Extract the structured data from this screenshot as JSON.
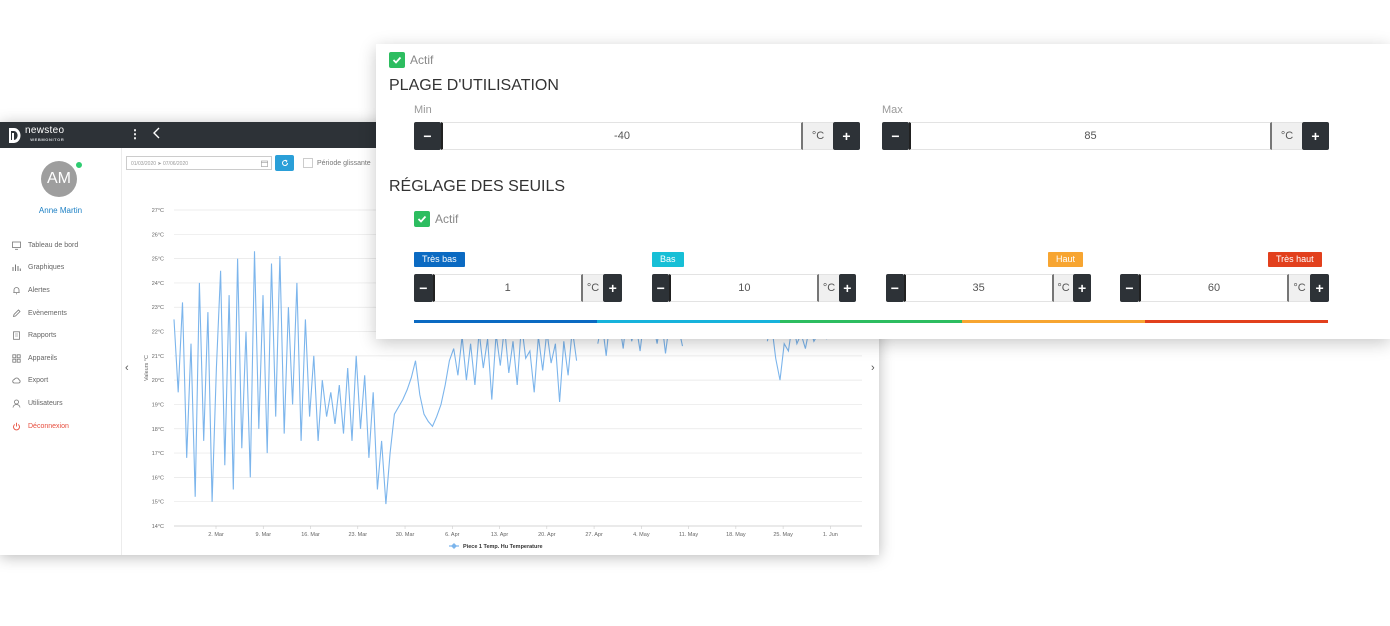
{
  "app": {
    "logo": {
      "name": "newsteo",
      "sub": "WEBMONITOR"
    },
    "sidebar": {
      "avatar": "AM",
      "user_name": "Anne Martin",
      "items": [
        {
          "label": "Tableau de bord",
          "icon": "monitor-icon"
        },
        {
          "label": "Graphiques",
          "icon": "bar-chart-icon"
        },
        {
          "label": "Alertes",
          "icon": "bell-icon"
        },
        {
          "label": "Evènements",
          "icon": "pencil-icon"
        },
        {
          "label": "Rapports",
          "icon": "document-icon"
        },
        {
          "label": "Appareils",
          "icon": "grid-icon"
        },
        {
          "label": "Export",
          "icon": "cloud-icon"
        },
        {
          "label": "Utilisateurs",
          "icon": "user-icon"
        },
        {
          "label": "Déconnexion",
          "icon": "power-icon"
        }
      ]
    },
    "filter": {
      "date_range": "01/03/2020 ➤ 07/06/2020",
      "sliding_label": "Période glissante"
    }
  },
  "chart_data": {
    "type": "line",
    "ylabel": "Valeurs °C",
    "ylim": [
      14,
      27
    ],
    "yticks": [
      "27°C",
      "26°C",
      "25°C",
      "24°C",
      "23°C",
      "22°C",
      "21°C",
      "20°C",
      "19°C",
      "18°C",
      "17°C",
      "16°C",
      "15°C",
      "14°C"
    ],
    "xticks": [
      "2. Mar",
      "9. Mar",
      "16. Mar",
      "23. Mar",
      "30. Mar",
      "6. Apr",
      "13. Apr",
      "20. Apr",
      "27. Apr",
      "4. May",
      "11. May",
      "18. May",
      "25. May",
      "1. Jun"
    ],
    "grid": true,
    "series": [
      {
        "name": "Piece 1 Temp. Hu Temperature",
        "color": "#7cb5ec",
        "x": [
          0,
          1,
          2,
          3,
          4,
          5,
          6,
          7,
          8,
          9,
          10,
          11,
          12,
          13,
          14,
          15,
          16,
          17,
          18,
          19,
          20,
          21,
          22,
          23,
          24,
          25,
          26,
          27,
          28,
          29,
          30,
          31,
          32,
          33,
          34,
          35,
          36,
          37,
          38,
          39,
          40,
          41,
          42,
          43,
          44,
          45,
          46,
          47,
          48,
          49,
          50,
          51,
          52,
          53,
          54,
          55,
          56,
          57,
          58,
          59,
          60,
          61,
          62,
          63,
          64,
          65,
          66,
          67,
          68,
          69,
          70,
          71,
          72,
          73,
          74,
          75,
          76,
          77,
          78,
          79,
          80,
          81,
          82,
          83,
          84,
          85,
          86,
          87,
          88,
          89,
          90,
          91,
          92,
          93,
          94,
          95
        ],
        "values": [
          22.5,
          19.5,
          23.2,
          16.8,
          21.5,
          15.2,
          24.0,
          17.5,
          22.8,
          15.0,
          20.5,
          24.5,
          16.5,
          23.5,
          15.5,
          25.0,
          17.2,
          22.0,
          16.0,
          25.3,
          18.0,
          23.5,
          17.0,
          24.8,
          18.5,
          25.1,
          17.8,
          23.0,
          19.0,
          24.0,
          17.5,
          22.5,
          18.5,
          21.0,
          17.5,
          20.0,
          18.5,
          19.5,
          18.2,
          19.8,
          17.8,
          20.5,
          17.5,
          21.0,
          18.0,
          20.2,
          16.8,
          19.5,
          15.5,
          17.5,
          14.9,
          17.0,
          18.6,
          18.9,
          19.2,
          19.6,
          20.1,
          20.8,
          19.4,
          18.6,
          18.3,
          18.1,
          18.5,
          19.0,
          19.8,
          20.8,
          21.3,
          20.2,
          21.8,
          20.0,
          21.5,
          19.8,
          22.0,
          20.5,
          21.7,
          19.2,
          21.9,
          20.6,
          22.2,
          20.3,
          21.6,
          19.8,
          22.3,
          20.9,
          21.2,
          19.5,
          21.8,
          20.4,
          22.0,
          20.7,
          21.5,
          19.1,
          21.6,
          20.2,
          22.1,
          20.8
        ],
        "segment_2": {
          "x": [
            100,
            101,
            102,
            103,
            104,
            105,
            106,
            107,
            108,
            109,
            110,
            111,
            112,
            113,
            114,
            115,
            116,
            117,
            118,
            119,
            120
          ],
          "values": [
            21.5,
            22.4,
            21.0,
            22.8,
            21.8,
            22.5,
            21.3,
            22.9,
            21.6,
            22.3,
            21.2,
            22.7,
            21.9,
            22.4,
            21.5,
            22.6,
            21.1,
            22.5,
            21.8,
            22.2,
            21.4
          ]
        },
        "segment_3": {
          "x": [
            140,
            141,
            142,
            143,
            144,
            145,
            146,
            147,
            148,
            149,
            150,
            151,
            152,
            153,
            154,
            155
          ],
          "values": [
            21.6,
            22.3,
            20.9,
            20.0,
            21.5,
            21.2,
            22.4,
            21.5,
            21.9,
            21.3,
            22.2,
            21.6,
            21.9,
            22.0,
            21.7,
            21.8
          ]
        }
      }
    ],
    "legend": "bottom"
  },
  "panel": {
    "active_label": "Actif",
    "usage_title": "PLAGE D'UTILISATION",
    "min": {
      "label": "Min",
      "value": "-40",
      "unit": "°C"
    },
    "max": {
      "label": "Max",
      "value": "85",
      "unit": "°C"
    },
    "thresholds_title": "RÉGLAGE DES SEUILS",
    "thresholds_active_label": "Actif",
    "thresholds": [
      {
        "label": "Très bas",
        "value": "1",
        "unit": "°C",
        "color": "#0b6ac2"
      },
      {
        "label": "Bas",
        "value": "10",
        "unit": "°C",
        "color": "#17bfd6"
      },
      {
        "label": "Haut",
        "value": "35",
        "unit": "°C",
        "color": "#f7a531"
      },
      {
        "label": "Très haut",
        "value": "60",
        "unit": "°C",
        "color": "#e2401d"
      }
    ],
    "scale_colors": [
      "#0b6ac2",
      "#17b3dc",
      "#2dbd60",
      "#f7a531",
      "#e2401d"
    ]
  }
}
